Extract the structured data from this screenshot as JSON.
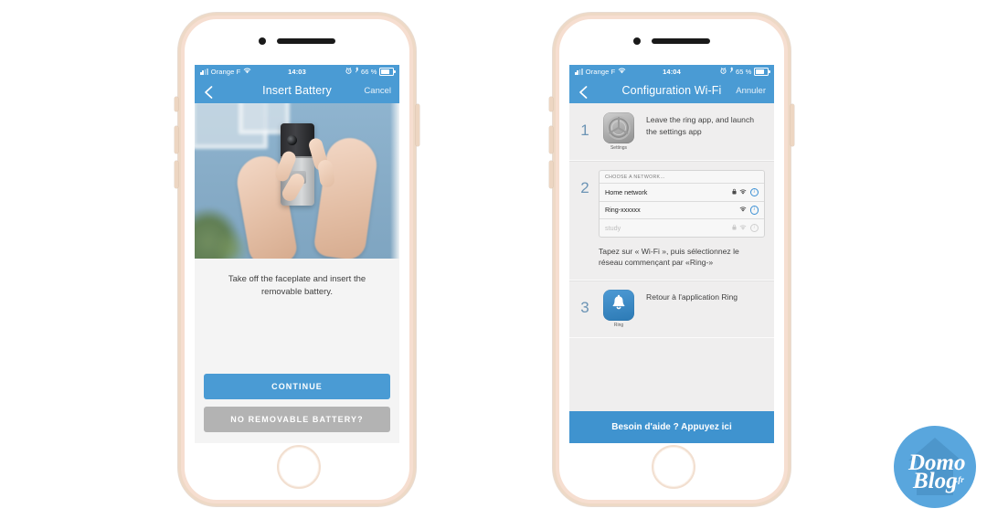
{
  "phones": [
    {
      "id": "left",
      "status_bar": {
        "carrier": "Orange F",
        "time": "14:03",
        "battery": "66 %",
        "icons": [
          "signal-bars-icon",
          "wifi-icon",
          "alarm-icon",
          "bluetooth-icon",
          "battery-icon"
        ]
      },
      "nav": {
        "back_icon": "chevron-left-icon",
        "title": "Insert Battery",
        "action": "Cancel"
      },
      "photo_alt": "Hands holding a Ring video doorbell, removing the faceplate",
      "caption": "Take off the faceplate and insert the removable battery.",
      "buttons": {
        "primary": "CONTINUE",
        "secondary": "NO REMOVABLE BATTERY?"
      }
    },
    {
      "id": "right",
      "status_bar": {
        "carrier": "Orange F",
        "time": "14:04",
        "battery": "65 %",
        "icons": [
          "signal-bars-icon",
          "wifi-icon",
          "alarm-icon",
          "bluetooth-icon",
          "battery-icon"
        ]
      },
      "nav": {
        "back_icon": "chevron-left-icon",
        "title": "Configuration Wi-Fi",
        "action": "Annuler"
      },
      "steps": [
        {
          "number": "1",
          "icon": "settings-gear-icon",
          "icon_label": "Settings",
          "text": "Leave the ring app, and launch the settings app"
        },
        {
          "number": "2",
          "wifi_panel": {
            "header": "CHOOSE A NETWORK…",
            "rows": [
              {
                "name": "Home network",
                "lock": true,
                "wifi": true,
                "info": true,
                "dim": false
              },
              {
                "name": "Ring-xxxxxx",
                "lock": false,
                "wifi": true,
                "info": true,
                "dim": false
              },
              {
                "name": "study",
                "lock": true,
                "wifi": true,
                "info": true,
                "dim": true
              }
            ]
          },
          "text": "Tapez sur « Wi-Fi », puis sélectionnez le réseau commençant par «Ring-»"
        },
        {
          "number": "3",
          "icon": "ring-bell-icon",
          "icon_label": "Ring",
          "text": "Retour à l'application Ring"
        }
      ],
      "help_bar": "Besoin d'aide ? Appuyez ici"
    }
  ],
  "watermark": {
    "name": "domoblog-logo",
    "line1": "Domo",
    "line2": "Blog",
    "suffix": ".fr"
  },
  "colors": {
    "ios_blue": "#4a9bd4",
    "help_blue": "#3f93cf",
    "secondary_grey": "#b3b3b3",
    "screen_grey": "#efeeee",
    "frame_rose": "#f6ded0",
    "step_number": "#6c94b5"
  }
}
